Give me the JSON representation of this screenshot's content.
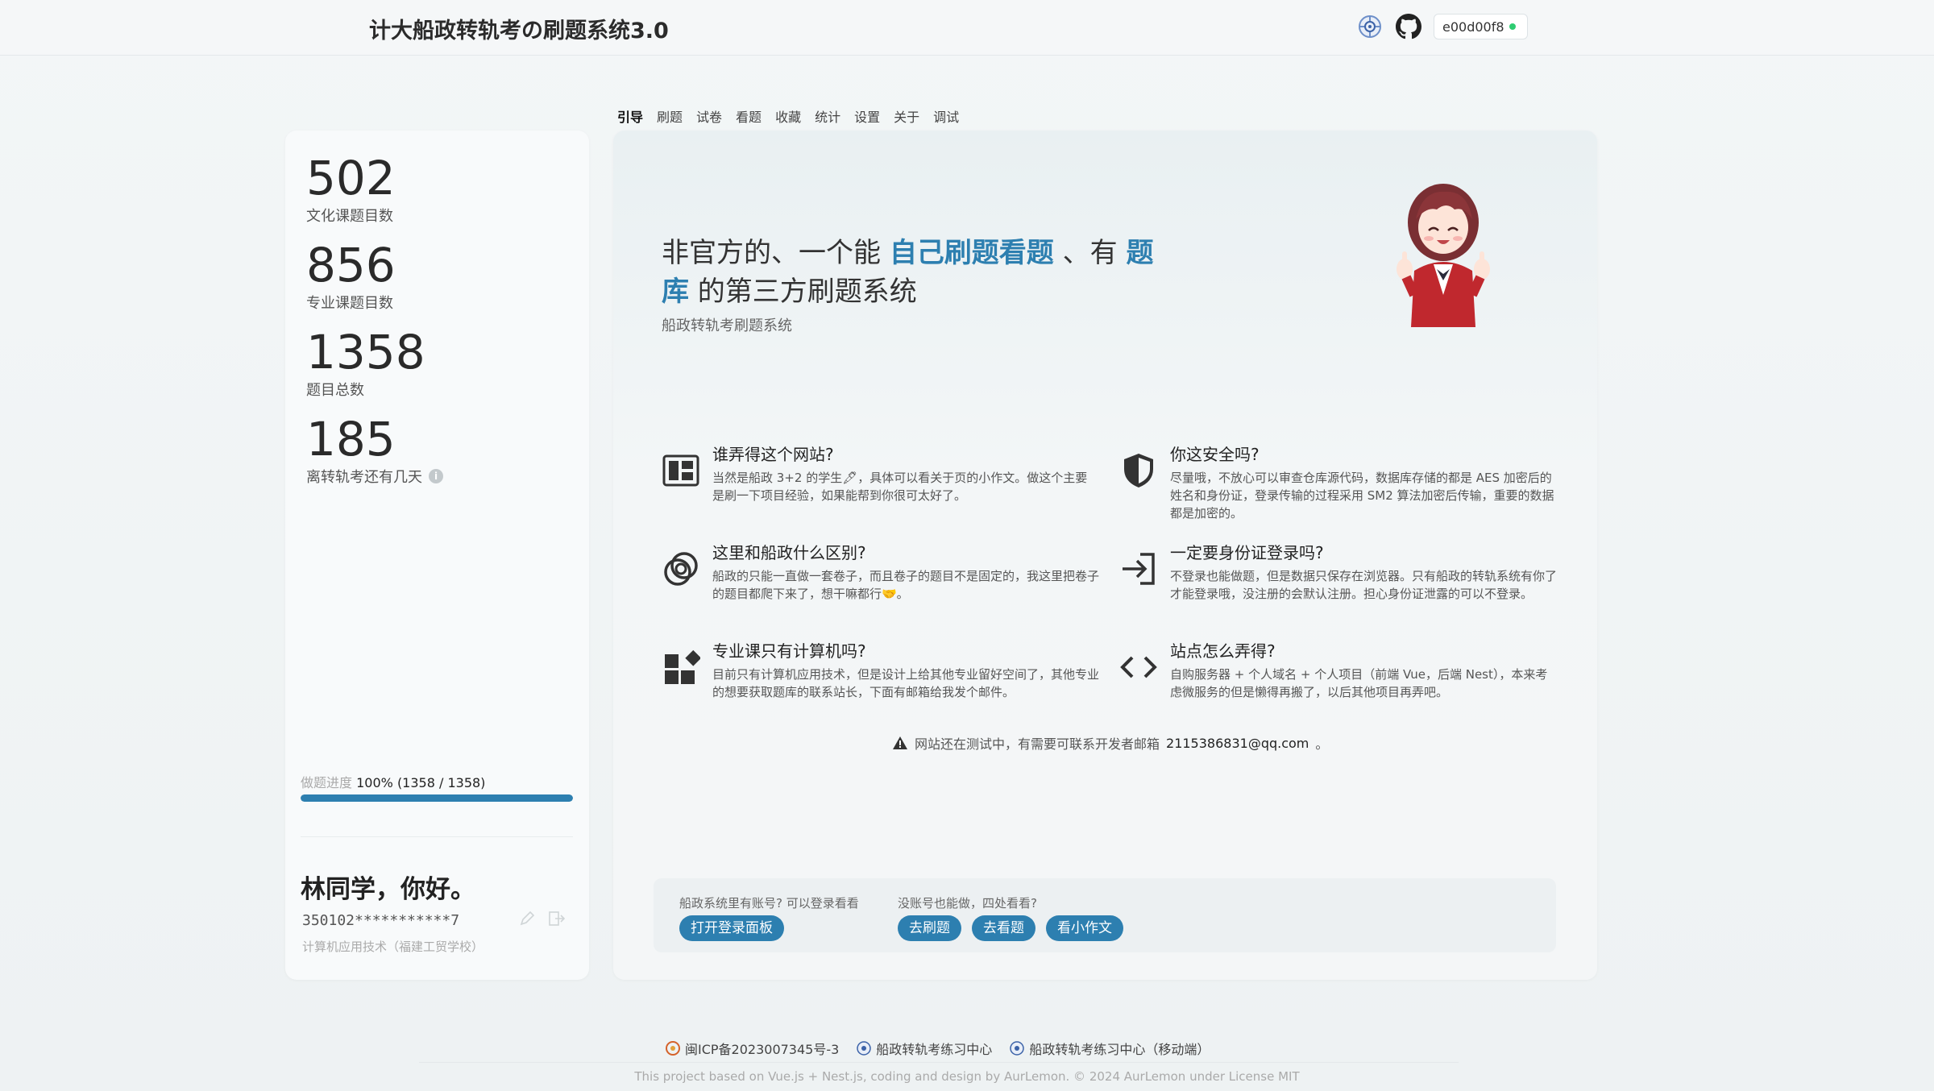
{
  "header": {
    "title": "计大船政转轨考の刷题系统3.0",
    "user_id": "e00d00f8"
  },
  "tabs": [
    "引导",
    "刷题",
    "试卷",
    "看题",
    "收藏",
    "统计",
    "设置",
    "关于",
    "调试"
  ],
  "active_tab": "引导",
  "stats": [
    {
      "value": "502",
      "label": "文化课题目数"
    },
    {
      "value": "856",
      "label": "专业课题目数"
    },
    {
      "value": "1358",
      "label": "题目总数"
    },
    {
      "value": "185",
      "label": "离转轨考还有几天"
    }
  ],
  "progress": {
    "label": "做题进度",
    "text": "100% (1358 / 1358)",
    "fraction": 1.0
  },
  "user": {
    "greeting": "林同学，你好。",
    "id_masked": "350102***********7",
    "major": "计算机应用技术（福建工贸学校）"
  },
  "hero": {
    "part1": "非官方的、一个能 ",
    "hl1": "自己刷题看题",
    "part2": " 、有 ",
    "hl2": "题库",
    "part3": " 的第三方刷题系统",
    "subtitle": "船政转轨考刷题系统"
  },
  "features": [
    {
      "icon": "dashboard-icon",
      "title": "谁弄得这个网站?",
      "text": "当然是船政 3+2 的学生🖋，具体可以看关于页的小作文。做这个主要是刷一下项目经验，如果能帮到你很可太好了。"
    },
    {
      "icon": "shield-icon",
      "title": "你这安全吗?",
      "text": "尽量哦，不放心可以审查仓库源代码，数据库存储的都是 AES 加密后的姓名和身份证，登录传输的过程采用 SM2 算法加密后传输，重要的数据都是加密的。"
    },
    {
      "icon": "rings-icon",
      "title": "这里和船政什么区别?",
      "text": "船政的只能一直做一套卷子，而且卷子的题目不是固定的，我这里把卷子的题目都爬下来了，想干嘛都行🤝。"
    },
    {
      "icon": "login-icon",
      "title": "一定要身份证登录吗?",
      "text": "不登录也能做题，但是数据只保存在浏览器。只有船政的转轨系统有你了才能登录哦，没注册的会默认注册。担心身份证泄露的可以不登录。"
    },
    {
      "icon": "blocks-icon",
      "title": "专业课只有计算机吗?",
      "text": "目前只有计算机应用技术，但是设计上给其他专业留好空间了，其他专业的想要获取题库的联系站长，下面有邮箱给我发个邮件。"
    },
    {
      "icon": "code-icon",
      "title": "站点怎么弄得?",
      "text": "自购服务器 + 个人域名 + 个人项目（前端 Vue，后端 Nest），本来考虑微服务的但是懒得再搬了，以后其他项目再弄吧。"
    }
  ],
  "notice": {
    "text": "网站还在测试中，有需要可联系开发者邮箱",
    "email": "2115386831@qq.com",
    "end": "。"
  },
  "cta": {
    "login_hint": "船政系统里有账号? 可以登录看看",
    "guest_hint": "没账号也能做，四处看看?",
    "open_login": "打开登录面板",
    "go_practice": "去刷题",
    "go_view": "去看题",
    "read_essay": "看小作文"
  },
  "footer": {
    "icp": "闽ICP备2023007345号-3",
    "link1": "船政转轨考练习中心",
    "link2": "船政转轨考练习中心（移动端）",
    "credit": "This project based on Vue.js + Nest.js, coding and design by AurLemon. © 2024 AurLemon under License MIT"
  },
  "colors": {
    "accent": "#2d7fb0",
    "online": "#2ecc71"
  }
}
